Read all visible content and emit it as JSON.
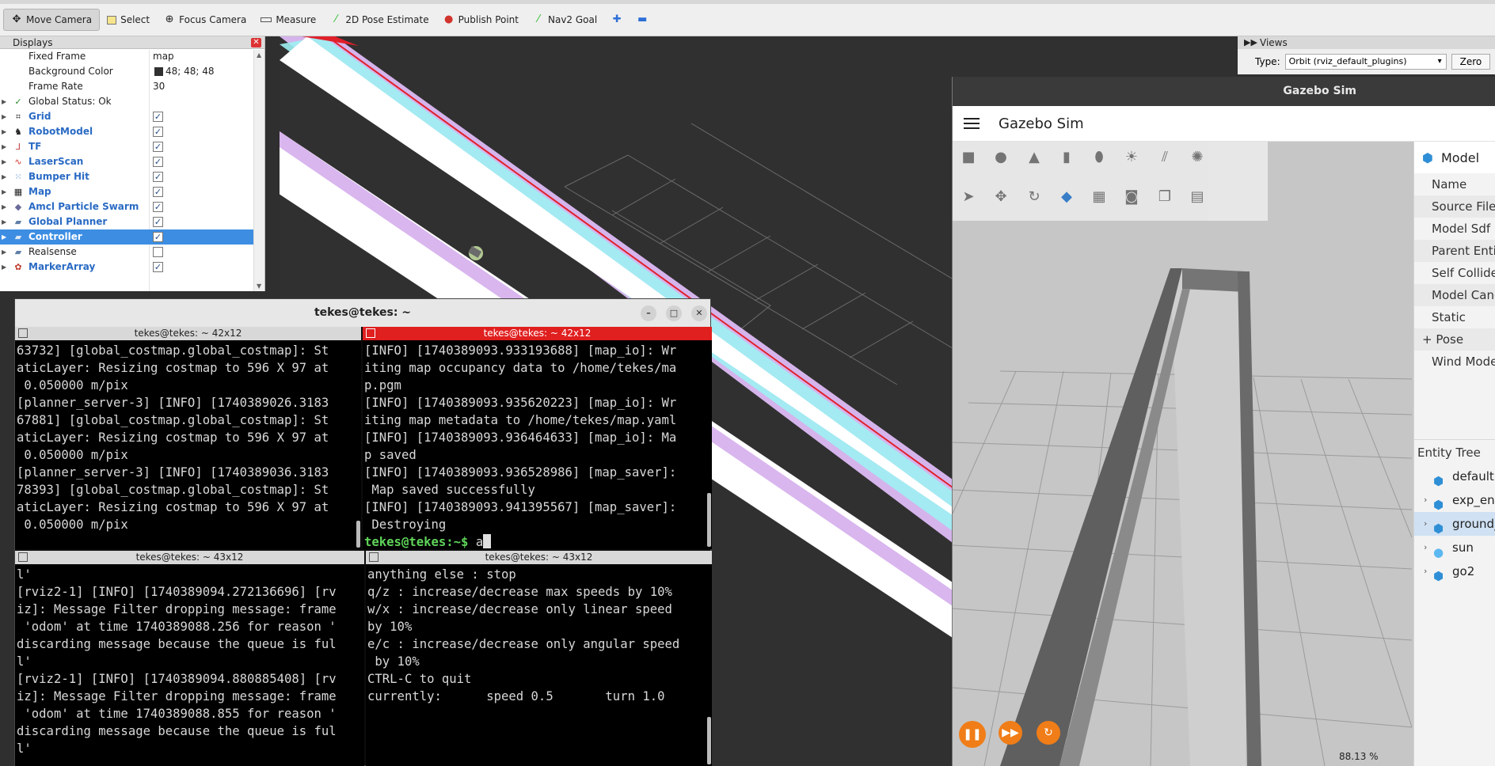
{
  "toolbar": {
    "items": [
      {
        "label": "Move Camera",
        "icon": "move-camera-icon",
        "active": true
      },
      {
        "label": "Select",
        "icon": "select-icon",
        "active": false
      },
      {
        "label": "Focus Camera",
        "icon": "focus-camera-icon",
        "active": false
      },
      {
        "label": "Measure",
        "icon": "measure-icon",
        "active": false
      },
      {
        "label": "2D Pose Estimate",
        "icon": "pose-estimate-icon",
        "active": false
      },
      {
        "label": "Publish Point",
        "icon": "publish-point-icon",
        "active": false
      },
      {
        "label": "Nav2 Goal",
        "icon": "nav2-goal-icon",
        "active": false
      }
    ]
  },
  "displays": {
    "title": "Displays",
    "fixed_frame_label": "Fixed Frame",
    "fixed_frame_value": "map",
    "bg_color_label": "Background Color",
    "bg_color_value": "48; 48; 48",
    "bg_color_hex": "#303030",
    "frame_rate_label": "Frame Rate",
    "frame_rate_value": "30",
    "global_status": "Global Status: Ok",
    "plugins": [
      {
        "name": "Grid",
        "checked": true
      },
      {
        "name": "RobotModel",
        "checked": true
      },
      {
        "name": "TF",
        "checked": true
      },
      {
        "name": "LaserScan",
        "checked": true
      },
      {
        "name": "Bumper Hit",
        "checked": true
      },
      {
        "name": "Map",
        "checked": true
      },
      {
        "name": "Amcl Particle Swarm",
        "checked": true
      },
      {
        "name": "Global Planner",
        "checked": true
      },
      {
        "name": "Controller",
        "checked": true
      },
      {
        "name": "Realsense",
        "checked": false
      },
      {
        "name": "MarkerArray",
        "checked": true
      }
    ]
  },
  "views": {
    "title": "Views",
    "type_label": "Type:",
    "type_value": "Orbit (rviz_default_plugins)",
    "zero_label": "Zero"
  },
  "gazebo": {
    "window_title": "Gazebo Sim",
    "app_title": "Gazebo Sim",
    "model_header": "Model",
    "properties": [
      "Name",
      "Source File",
      "Model Sdf",
      "Parent Entity",
      "Self Collide",
      "Model Canonical",
      "Static",
      "+ Pose",
      "Wind Mode"
    ],
    "entity_tree_title": "Entity Tree",
    "entities": [
      {
        "name": "default",
        "caret": false,
        "selected": false
      },
      {
        "name": "exp_env",
        "caret": true,
        "selected": false
      },
      {
        "name": "ground_plane",
        "caret": true,
        "selected": true
      },
      {
        "name": "sun",
        "caret": true,
        "selected": false
      },
      {
        "name": "go2",
        "caret": true,
        "selected": false
      }
    ],
    "zoom_text": "88.13 %",
    "accent": "#f07d17"
  },
  "terminal": {
    "title": "tekes@tekes: ~",
    "panes": [
      {
        "header": "tekes@tekes: ~ 42x12",
        "lines": [
          "63732] [global_costmap.global_costmap]: St",
          "aticLayer: Resizing costmap to 596 X 97 at",
          " 0.050000 m/pix",
          "[planner_server-3] [INFO] [1740389026.3183",
          "67881] [global_costmap.global_costmap]: St",
          "aticLayer: Resizing costmap to 596 X 97 at",
          " 0.050000 m/pix",
          "[planner_server-3] [INFO] [1740389036.3183",
          "78393] [global_costmap.global_costmap]: St",
          "aticLayer: Resizing costmap to 596 X 97 at",
          " 0.050000 m/pix"
        ]
      },
      {
        "header": "tekes@tekes: ~ 42x12",
        "lines": [
          "[INFO] [1740389093.933193688] [map_io]: Wr",
          "iting map occupancy data to /home/tekes/ma",
          "p.pgm",
          "[INFO] [1740389093.935620223] [map_io]: Wr",
          "iting map metadata to /home/tekes/map.yaml",
          "[INFO] [1740389093.936464633] [map_io]: Ma",
          "p saved",
          "[INFO] [1740389093.936528986] [map_saver]:",
          " Map saved successfully",
          "[INFO] [1740389093.941395567] [map_saver]:",
          " Destroying"
        ],
        "prompt": "tekes@tekes:~$ ",
        "typed": "a"
      },
      {
        "header": "tekes@tekes: ~ 43x12",
        "lines": [
          "l'",
          "[rviz2-1] [INFO] [1740389094.272136696] [rv",
          "iz]: Message Filter dropping message: frame",
          " 'odom' at time 1740389088.256 for reason '",
          "discarding message because the queue is ful",
          "l'",
          "[rviz2-1] [INFO] [1740389094.880885408] [rv",
          "iz]: Message Filter dropping message: frame",
          " 'odom' at time 1740389088.855 for reason '",
          "discarding message because the queue is ful",
          "l'"
        ]
      },
      {
        "header": "tekes@tekes: ~ 43x12",
        "lines": [
          "anything else : stop",
          "",
          "q/z : increase/decrease max speeds by 10%",
          "w/x : increase/decrease only linear speed",
          "by 10%",
          "e/c : increase/decrease only angular speed",
          " by 10%",
          "",
          "CTRL-C to quit",
          "",
          "currently:      speed 0.5       turn 1.0"
        ]
      }
    ]
  }
}
